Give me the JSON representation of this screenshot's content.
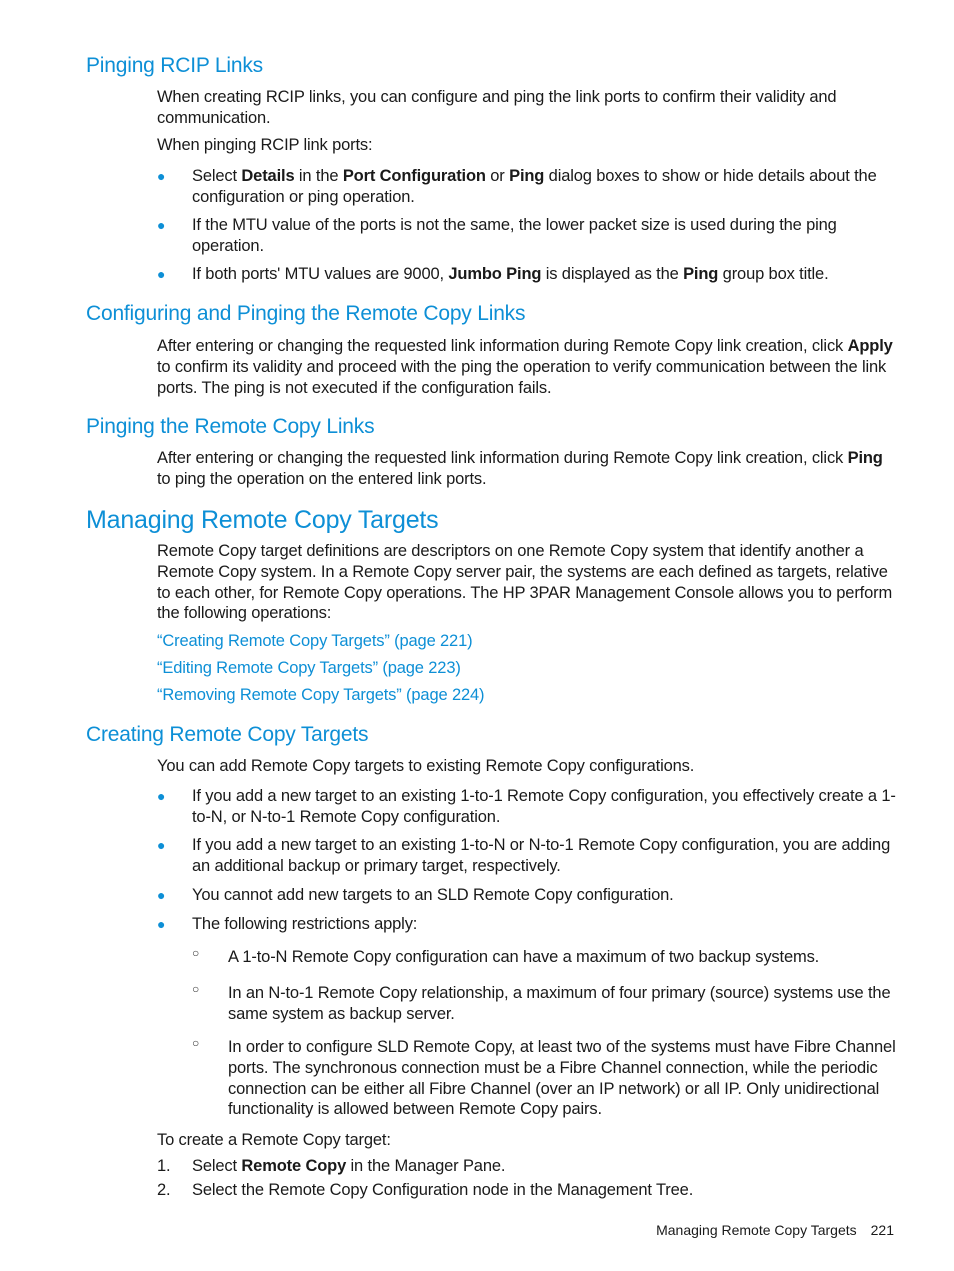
{
  "sections": {
    "rcip": {
      "heading": "Pinging RCIP Links",
      "intro": "When creating RCIP links, you can configure and ping the link ports to confirm their validity and communication.",
      "lead": "When pinging RCIP link ports:",
      "bullets": [
        {
          "parts": [
            "Select ",
            "Details",
            " in the ",
            "Port Configuration",
            " or ",
            "Ping",
            " dialog boxes to show or hide details about the configuration or ping operation."
          ]
        },
        {
          "text": "If the MTU value of the ports is not the same, the lower packet size is used during the ping operation."
        },
        {
          "parts": [
            "If both ports' MTU values are 9000, ",
            "Jumbo Ping",
            " is displayed as the ",
            "Ping",
            " group box title."
          ]
        }
      ]
    },
    "configuring": {
      "heading": "Configuring and Pinging the Remote Copy Links",
      "text_pre": "After entering or changing the requested link information during Remote Copy link creation, click ",
      "bold": "Apply",
      "text_post": " to confirm its validity and proceed with the ping the operation to verify communication between the link ports. The ping is not executed if the configuration fails."
    },
    "pinging": {
      "heading": "Pinging the Remote Copy Links",
      "text_pre": "After entering or changing the requested link information during Remote Copy link creation, click ",
      "bold": "Ping",
      "text_post": " to ping the operation on the entered link ports."
    },
    "managing": {
      "heading": "Managing Remote Copy Targets",
      "text": "Remote Copy target definitions are descriptors on one Remote Copy system that identify another a Remote Copy system. In a Remote Copy server pair, the systems are each defined as targets, relative to each other, for Remote Copy operations. The HP 3PAR Management Console allows you to perform the following operations:",
      "links": [
        "“Creating Remote Copy Targets” (page 221)",
        "“Editing Remote Copy Targets” (page 223)",
        "“Removing Remote Copy Targets” (page 224)"
      ]
    },
    "creating": {
      "heading": "Creating Remote Copy Targets",
      "intro": "You can add Remote Copy targets to existing Remote Copy configurations.",
      "bullets": [
        "If you add a new target to an existing 1-to-1 Remote Copy configuration, you effectively create a 1-to-N, or N-to-1 Remote Copy configuration.",
        "If you add a new target to an existing 1-to-N or N-to-1 Remote Copy configuration, you are adding an additional backup or primary target, respectively.",
        "You cannot add new targets to an SLD Remote Copy configuration.",
        "The following restrictions apply:"
      ],
      "sub_bullets": [
        "A 1-to-N Remote Copy configuration can have a maximum of two backup systems.",
        "In an N-to-1 Remote Copy relationship, a maximum of four primary (source) systems use the same system as backup server.",
        "In order to configure SLD Remote Copy, at least two of the systems must have Fibre Channel ports. The synchronous connection must be a Fibre Channel connection, while the periodic connection can be either all Fibre Channel (over an IP network) or all IP. Only unidirectional functionality is allowed between Remote Copy pairs."
      ],
      "steps_lead": "To create a Remote Copy target:",
      "steps": [
        {
          "n": "1.",
          "pre": "Select ",
          "bold": "Remote Copy",
          "post": " in the Manager Pane."
        },
        {
          "n": "2.",
          "pre": "Select the Remote Copy Configuration node in the Management Tree.",
          "bold": "",
          "post": ""
        }
      ]
    }
  },
  "footer": {
    "title": "Managing Remote Copy Targets",
    "page": "221"
  },
  "colors": {
    "heading": "#0d8fd6",
    "link": "#0d8fd6",
    "bullet": "#0d8fd6"
  }
}
